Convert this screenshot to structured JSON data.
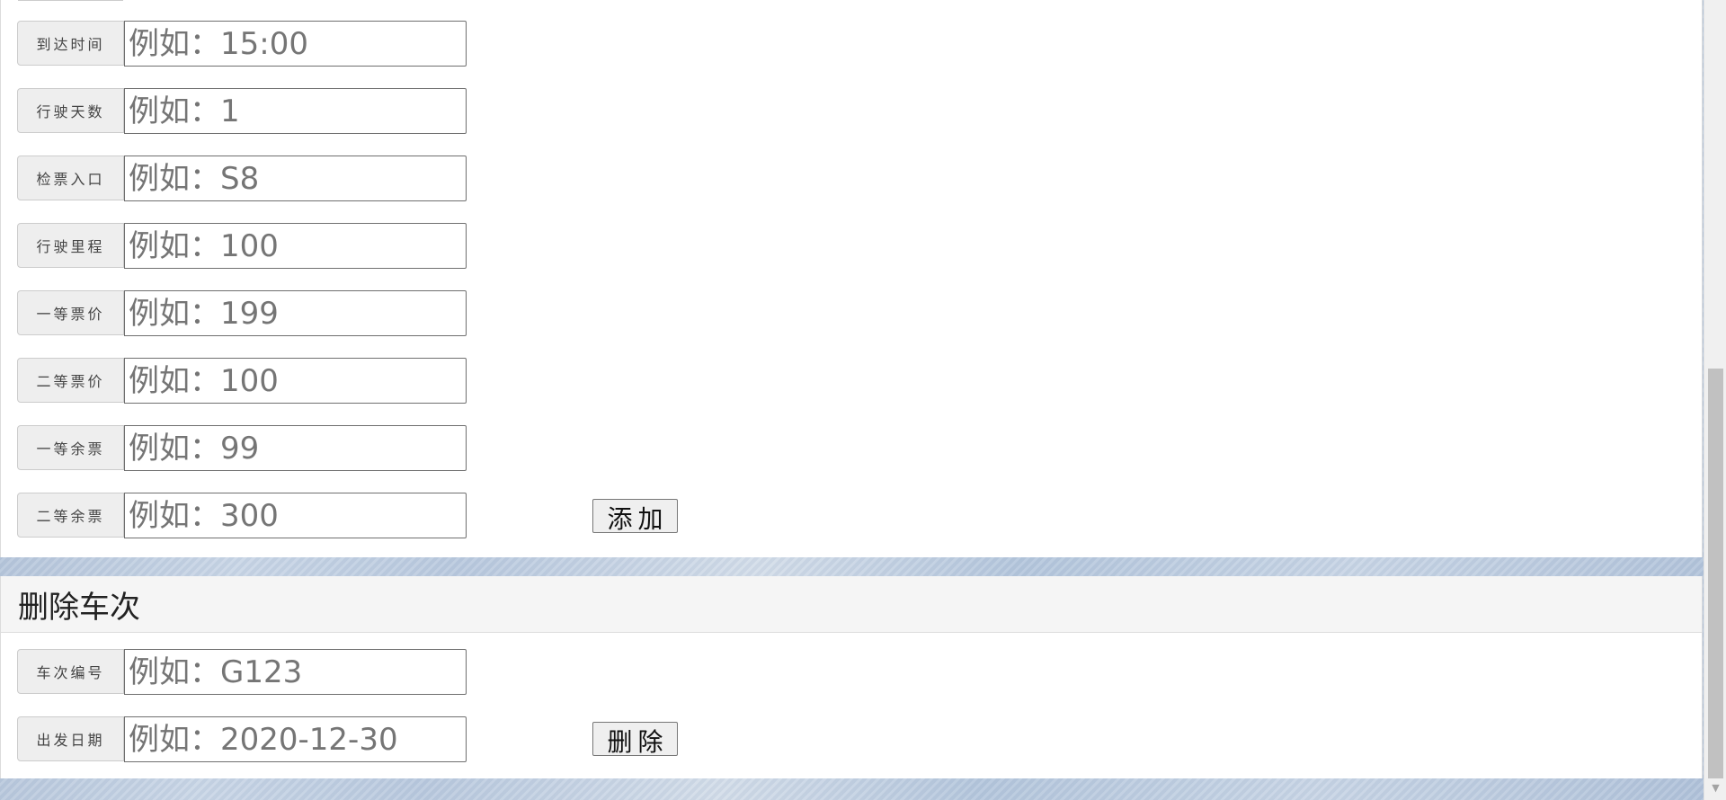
{
  "add_form": {
    "rows": [
      {
        "label": "到达时间",
        "placeholder": "例如：15:00"
      },
      {
        "label": "行驶天数",
        "placeholder": "例如：1"
      },
      {
        "label": "检票入口",
        "placeholder": "例如：S8"
      },
      {
        "label": "行驶里程",
        "placeholder": "例如：100"
      },
      {
        "label": "一等票价",
        "placeholder": "例如：199"
      },
      {
        "label": "二等票价",
        "placeholder": "例如：100"
      },
      {
        "label": "一等余票",
        "placeholder": "例如：99"
      },
      {
        "label": "二等余票",
        "placeholder": "例如：300"
      }
    ],
    "submit_label": "添加"
  },
  "delete_form": {
    "title": "删除车次",
    "rows": [
      {
        "label": "车次编号",
        "placeholder": "例如：G123"
      },
      {
        "label": "出发日期",
        "placeholder": "例如：2020-12-30"
      }
    ],
    "submit_label": "删除"
  },
  "icons": {
    "scroll_down": "scroll-down-arrow-icon"
  },
  "colors": {
    "panel_bg": "#ffffff",
    "addon_bg": "#eeeeee",
    "heading_bg": "#f5f5f5",
    "button_bg": "#efefef"
  }
}
